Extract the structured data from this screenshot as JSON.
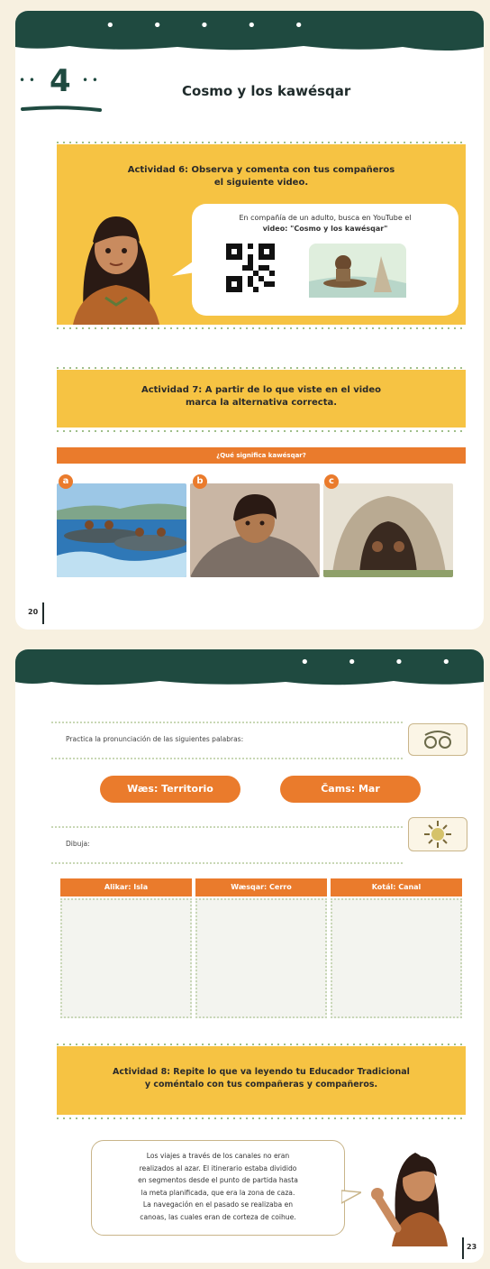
{
  "page_left": {
    "lesson_number": "4",
    "lesson_title": "Cosmo y los kawésqar",
    "activity6": {
      "title_line1": "Actividad 6: Observa y comenta con tus compañeros",
      "title_line2": "el siguiente video.",
      "bubble_line1": "En compañía de un adulto, busca en YouTube el",
      "bubble_line2": "video: \"Cosmo y los kawésqar\""
    },
    "activity7": {
      "title_line1": "Actividad 7: A partir de lo que viste en el video",
      "title_line2": "marca la alternativa correcta.",
      "question": "¿Qué significa kawésqar?",
      "options": [
        "a",
        "b",
        "c"
      ]
    },
    "page_number": "20"
  },
  "page_right": {
    "practice_label": "Practica la pronunciación de las siguientes palabras:",
    "words": [
      "Wæs: Territorio",
      "Čams: Mar"
    ],
    "draw_label": "Dibuja:",
    "columns": [
      "Alikar: Isla",
      "Wæsqar: Cerro",
      "Kotál: Canal"
    ],
    "activity8": {
      "title_line1": "Actividad 8: Repite lo que va leyendo tu Educador Tradicional",
      "title_line2": "y coméntalo con tus compañeras y compañeros."
    },
    "story_lines": [
      "Los viajes a través de los canales no eran",
      "realizados al azar. El itinerario estaba dividido",
      "en segmentos desde el punto de partida hasta",
      "la meta planificada, que era la zona de caza.",
      "La navegación en el pasado se realizaba en",
      "canoas, las cuales eran de corteza de coihue."
    ],
    "page_number": "23"
  },
  "colors": {
    "banner": "#1f4a40",
    "yellow": "#f6c343",
    "orange": "#ea7b2c",
    "background": "#f7f0e0"
  },
  "icons": [
    "qr-code-icon",
    "eyes-icon",
    "sun-hands-icon"
  ]
}
